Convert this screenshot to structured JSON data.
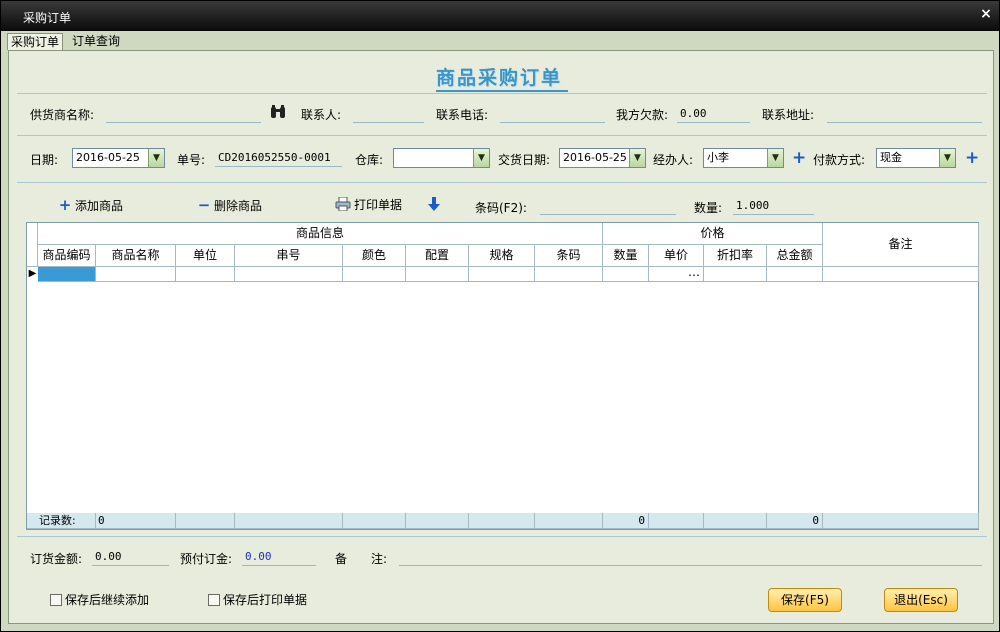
{
  "window": {
    "title": "采购订单",
    "close_glyph": "×"
  },
  "tabs": [
    {
      "label": "采购订单"
    },
    {
      "label": "订单查询"
    }
  ],
  "heading": "商品采购订单",
  "supplier": {
    "name_label": "供货商名称:",
    "name_value": "",
    "search_icon": "binoculars-icon",
    "contact_label": "联系人:",
    "contact_value": "",
    "phone_label": "联系电话:",
    "phone_value": "",
    "owed_label": "我方欠款:",
    "owed_value": "0.00",
    "address_label": "联系地址:",
    "address_value": ""
  },
  "order": {
    "date_label": "日期:",
    "date_value": "2016-05-25",
    "number_label": "单号:",
    "number_value": "CD2016052550-0001",
    "warehouse_label": "仓库:",
    "warehouse_value": "",
    "delivery_label": "交货日期:",
    "delivery_value": "2016-05-25",
    "handler_label": "经办人:",
    "handler_value": "小李",
    "payment_label": "付款方式:",
    "payment_value": "现金"
  },
  "toolbar": {
    "add_label": "添加商品",
    "delete_label": "删除商品",
    "print_label": "打印单据",
    "barcode_label": "条码(F2):",
    "barcode_value": "",
    "quantity_label": "数量:",
    "quantity_value": "1.000"
  },
  "grid": {
    "group_goods": "商品信息",
    "group_price": "价格",
    "remarks_header": "备注",
    "columns": [
      "商品编码",
      "商品名称",
      "单位",
      "串号",
      "颜色",
      "配置",
      "规格",
      "条码",
      "数量",
      "单价",
      "折扣率",
      "总金额"
    ],
    "row_indicator": "▶",
    "cell_ellipsis": "…",
    "footer_label": "记录数:",
    "footer_count": "0",
    "footer_qty": "0",
    "footer_total": "0"
  },
  "summary": {
    "amount_label": "订货金额:",
    "amount_value": "0.00",
    "deposit_label": "预付订金:",
    "deposit_value": "0.00",
    "remark_label": "备　　注:",
    "remark_value": ""
  },
  "options": {
    "continue_label": "保存后继续添加",
    "print_label": "保存后打印单据"
  },
  "buttons": {
    "save": "保存(F5)",
    "exit": "退出(Esc)"
  },
  "colors": {
    "accent": "#3a96c8",
    "title_bg": "#0a0a0a",
    "panel_bg": "#e8ecdc",
    "button": "#ffc440"
  }
}
